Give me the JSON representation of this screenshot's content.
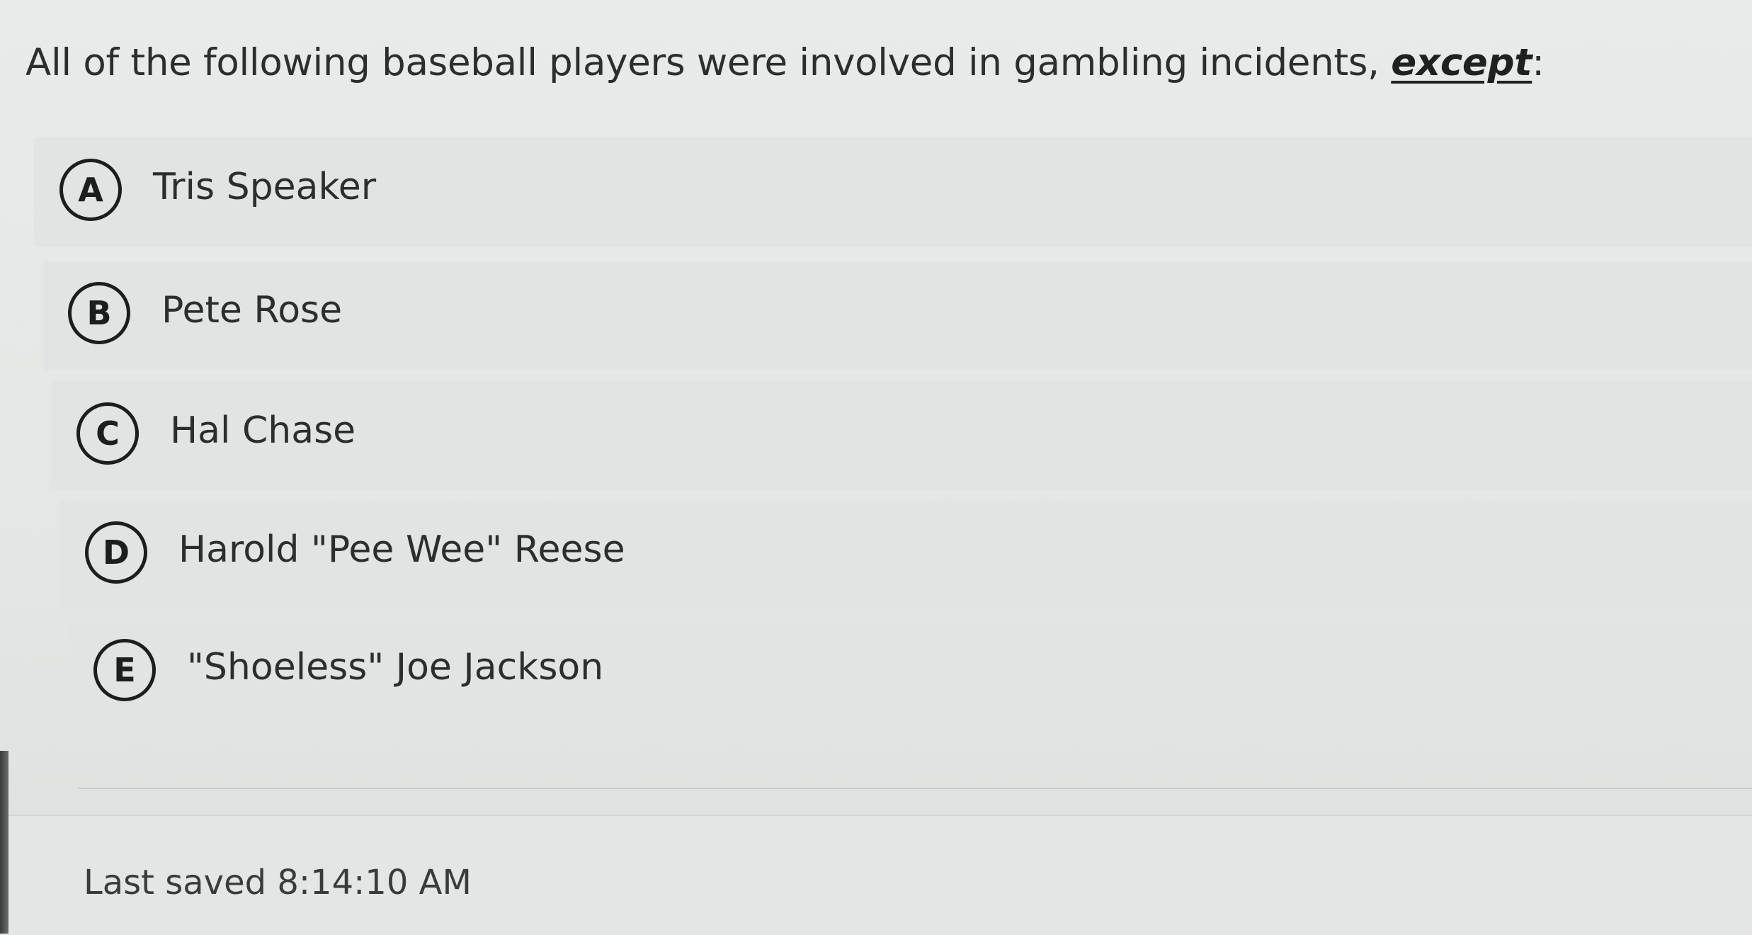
{
  "question": {
    "text_before": "All of the following baseball players were involved in gambling incidents, ",
    "emphasis": "except",
    "text_after": ":"
  },
  "options": [
    {
      "letter": "A",
      "label": "Tris Speaker"
    },
    {
      "letter": "B",
      "label": "Pete Rose"
    },
    {
      "letter": "C",
      "label": "Hal Chase"
    },
    {
      "letter": "D",
      "label": "Harold \"Pee Wee\" Reese"
    },
    {
      "letter": "E",
      "label": "\"Shoeless\" Joe Jackson"
    }
  ],
  "status": {
    "last_saved": "Last saved 8:14:10 AM"
  }
}
